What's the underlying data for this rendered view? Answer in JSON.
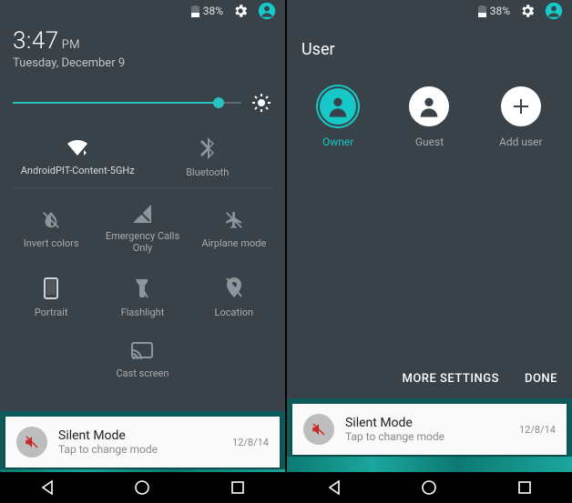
{
  "status": {
    "battery_pct": "38%"
  },
  "left": {
    "time": "3:47",
    "ampm": "PM",
    "date": "Tuesday, December 9",
    "slider_pct": 90,
    "row1": {
      "wifi": "AndroidPIT-Content-5GHz",
      "bt": "Bluetooth"
    },
    "tiles": {
      "invert": "Invert colors",
      "emerg": "Emergency Calls Only",
      "airplane": "Airplane mode",
      "portrait": "Portrait",
      "flash": "Flashlight",
      "location": "Location",
      "cast": "Cast screen"
    }
  },
  "right": {
    "title": "User",
    "owner": "Owner",
    "guest": "Guest",
    "add": "Add user",
    "more": "MORE SETTINGS",
    "done": "DONE"
  },
  "notif": {
    "title": "Silent Mode",
    "sub": "Tap to change mode",
    "date": "12/8/14"
  }
}
